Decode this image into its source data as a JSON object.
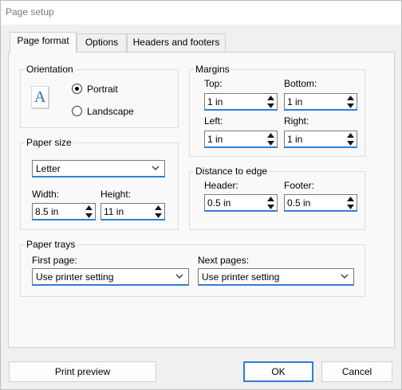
{
  "window": {
    "title": "Page setup"
  },
  "tabs": [
    {
      "label": "Page format",
      "active": true
    },
    {
      "label": "Options",
      "active": false
    },
    {
      "label": "Headers and footers",
      "active": false
    }
  ],
  "orientation": {
    "group_label": "Orientation",
    "portrait_label": "Portrait",
    "landscape_label": "Landscape",
    "selected": "Portrait",
    "icon_glyph": "A"
  },
  "margins": {
    "group_label": "Margins",
    "top_label": "Top:",
    "top_value": "1 in",
    "bottom_label": "Bottom:",
    "bottom_value": "1 in",
    "left_label": "Left:",
    "left_value": "1 in",
    "right_label": "Right:",
    "right_value": "1 in"
  },
  "paper_size": {
    "group_label": "Paper size",
    "selected": "Letter",
    "width_label": "Width:",
    "width_value": "8.5 in",
    "height_label": "Height:",
    "height_value": "11 in"
  },
  "distance": {
    "group_label": "Distance to edge",
    "header_label": "Header:",
    "header_value": "0.5 in",
    "footer_label": "Footer:",
    "footer_value": "0.5 in"
  },
  "trays": {
    "group_label": "Paper trays",
    "first_label": "First page:",
    "first_value": "Use printer setting",
    "next_label": "Next pages:",
    "next_value": "Use printer setting"
  },
  "buttons": {
    "print_preview": "Print preview",
    "ok": "OK",
    "cancel": "Cancel"
  },
  "colors": {
    "accent": "#2d7fd7",
    "icon_blue": "#2b6cb0"
  }
}
